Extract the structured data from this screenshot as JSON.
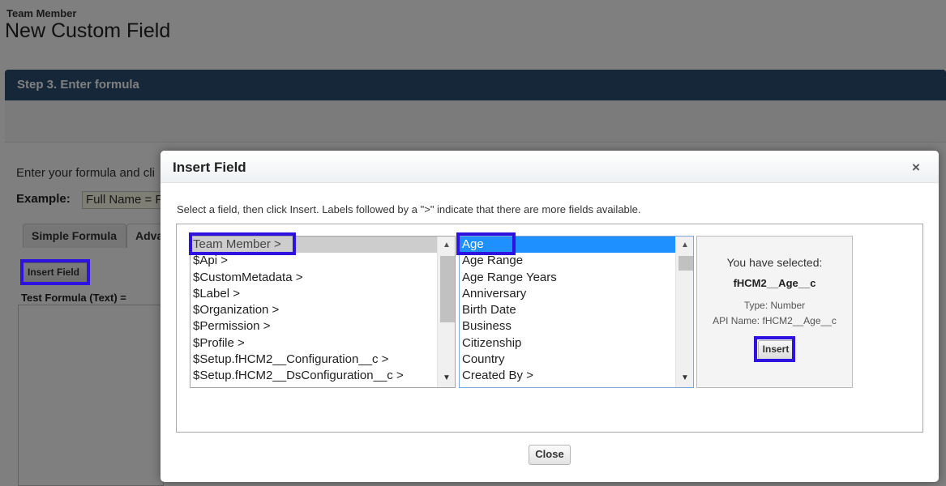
{
  "page": {
    "object_name": "Team Member",
    "title": "New Custom Field",
    "step_title": "Step 3. Enter formula",
    "instructions": "Enter your formula and cli",
    "example_label": "Example:",
    "example_value": "Full Name = F",
    "tabs": [
      {
        "label": "Simple Formula"
      },
      {
        "label": "Adva"
      }
    ],
    "insert_field_button": "Insert Field",
    "test_formula_label": "Test Formula (Text) ="
  },
  "modal": {
    "title": "Insert Field",
    "close_icon": "×",
    "instructions": "Select a field, then click Insert. Labels followed by a \">\" indicate that there are more fields available.",
    "left_list": {
      "items": [
        "Team Member >",
        "$Api >",
        "$CustomMetadata >",
        "$Label >",
        "$Organization >",
        "$Permission >",
        "$Profile >",
        "$Setup.fHCM2__Configuration__c >",
        "$Setup.fHCM2__DsConfiguration__c >"
      ],
      "selected": "Team Member >"
    },
    "middle_list": {
      "items": [
        "Age",
        "Age Range",
        "Age Range Years",
        "Anniversary",
        "Birth Date",
        "Business",
        "Citizenship",
        "Country",
        "Created By >"
      ],
      "selected": "Age"
    },
    "selection": {
      "heading": "You have selected:",
      "field_name": "fHCM2__Age__c",
      "type": "Type: Number",
      "api_name": "API Name: fHCM2__Age__c",
      "insert_button": "Insert"
    },
    "close_button": "Close"
  },
  "icons": {
    "scroll_up": "scroll-up-arrow-icon",
    "scroll_down": "scroll-down-arrow-icon",
    "close": "close-icon"
  },
  "colors": {
    "highlight": "#2d12e0",
    "selection_blue": "#1e90ff",
    "step_bar": "#2b4e73"
  }
}
